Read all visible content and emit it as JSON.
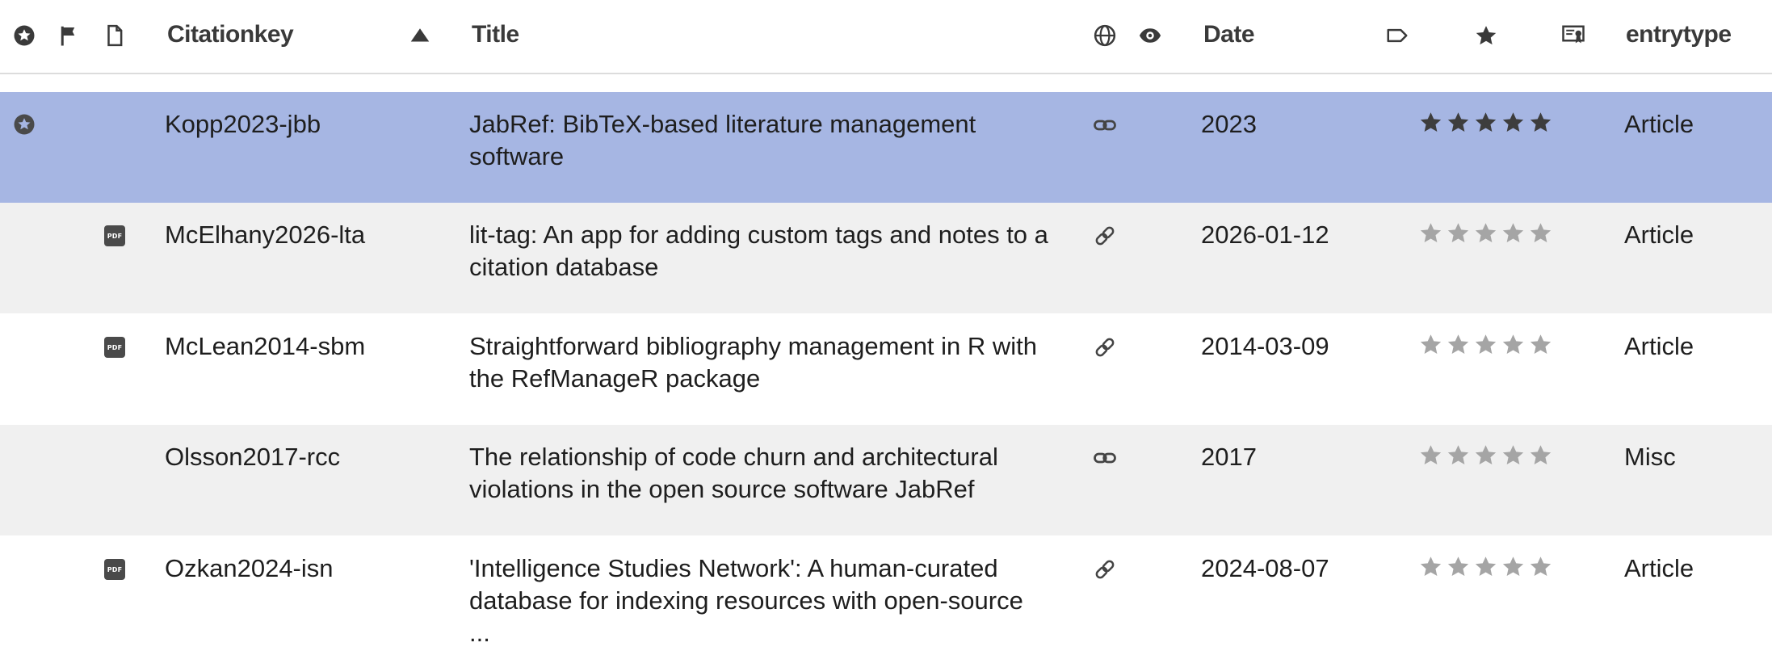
{
  "header": {
    "citationkey": "Citationkey",
    "title": "Title",
    "date": "Date",
    "entrytype": "entrytype"
  },
  "icons": {
    "col_ranking": "ranking-star-circle-icon",
    "col_flag": "flag-icon",
    "col_file": "file-icon",
    "sort": "sort-ascending-triangle-icon",
    "col_url": "globe-icon",
    "col_readstatus": "eye-icon",
    "col_groups": "tag-icon",
    "col_rank": "star-icon",
    "col_printed": "certificate-icon",
    "row_link": "link-icon",
    "row_pdf": "pdf-icon"
  },
  "colors": {
    "selected_row": "#a6b6e3",
    "alt_row": "#f0f0f0",
    "star_filled": "#3d3d3d",
    "star_empty": "#a5a5a5"
  },
  "rows": [
    {
      "key": "Kopp2023-jbb",
      "title1": "JabRef: BibTeX-based literature management",
      "title2": "software",
      "date": "2023",
      "type": "Article",
      "rating": 5,
      "pdf": false,
      "link": "chain",
      "selected": true,
      "ranked": true,
      "pdf_label": ""
    },
    {
      "key": "McElhany2026-lta",
      "title1": "lit-tag: An app for adding custom tags and notes to a",
      "title2": "citation database",
      "date": "2026-01-12",
      "type": "Article",
      "rating": 0,
      "pdf": true,
      "link": "doi",
      "selected": false,
      "ranked": false,
      "pdf_label": "PDF"
    },
    {
      "key": "McLean2014-sbm",
      "title1": "Straightforward bibliography management in R with",
      "title2": "the RefManageR package",
      "date": "2014-03-09",
      "type": "Article",
      "rating": 0,
      "pdf": true,
      "link": "doi",
      "selected": false,
      "ranked": false,
      "pdf_label": "PDF"
    },
    {
      "key": "Olsson2017-rcc",
      "title1": "The relationship of code churn and architectural",
      "title2": "violations in the open source software JabRef",
      "date": "2017",
      "type": "Misc",
      "rating": 0,
      "pdf": false,
      "link": "chain",
      "selected": false,
      "ranked": false,
      "pdf_label": ""
    },
    {
      "key": "Ozkan2024-isn",
      "title1": "'Intelligence Studies Network': A human-curated",
      "title2": "database for indexing resources with open-source ...",
      "date": "2024-08-07",
      "type": "Article",
      "rating": 0,
      "pdf": true,
      "link": "doi",
      "selected": false,
      "ranked": false,
      "pdf_label": "PDF"
    }
  ]
}
